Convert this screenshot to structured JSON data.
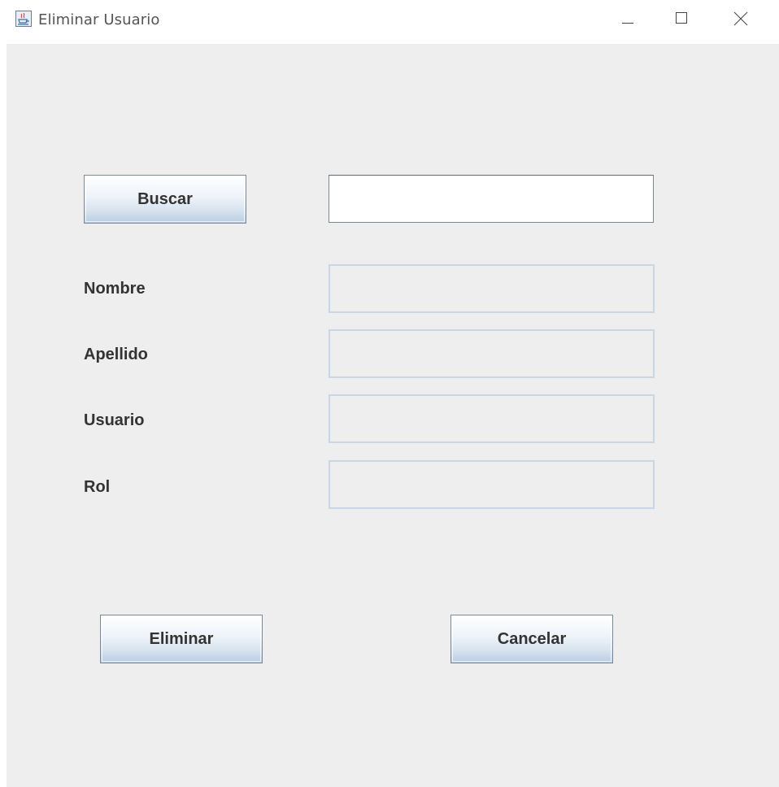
{
  "window": {
    "title": "Eliminar Usuario",
    "accent_color": "#b9cde2",
    "background_color": "#eeeeee"
  },
  "search": {
    "button_label": "Buscar",
    "value": "",
    "placeholder": ""
  },
  "fields": {
    "nombre": {
      "label": "Nombre",
      "value": ""
    },
    "apellido": {
      "label": "Apellido",
      "value": ""
    },
    "usuario": {
      "label": "Usuario",
      "value": ""
    },
    "rol": {
      "label": "Rol",
      "value": ""
    }
  },
  "actions": {
    "delete_label": "Eliminar",
    "cancel_label": "Cancelar"
  },
  "icons": {
    "app": "java-cup-icon",
    "minimize": "minimize-icon",
    "maximize": "maximize-icon",
    "close": "close-icon"
  }
}
